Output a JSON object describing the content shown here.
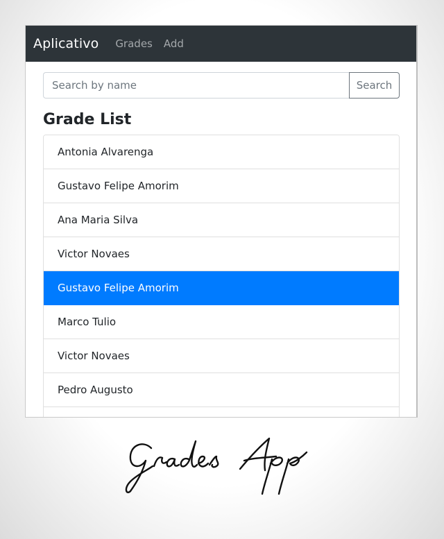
{
  "navbar": {
    "brand": "Aplicativo",
    "links": [
      "Grades",
      "Add"
    ]
  },
  "search": {
    "placeholder": "Search by name",
    "value": "",
    "button_label": "Search"
  },
  "main": {
    "title": "Grade List",
    "items": [
      "Antonia Alvarenga",
      "Gustavo Felipe Amorim",
      "Ana Maria Silva",
      "Victor Novaes",
      "Gustavo Felipe Amorim",
      "Marco Tulio",
      "Victor Novaes",
      "Pedro Augusto",
      ""
    ],
    "selected_index": 4
  },
  "colors": {
    "navbar_bg": "#2d3439",
    "selected_bg": "#007bff"
  },
  "caption": {
    "text": "Grades App"
  }
}
